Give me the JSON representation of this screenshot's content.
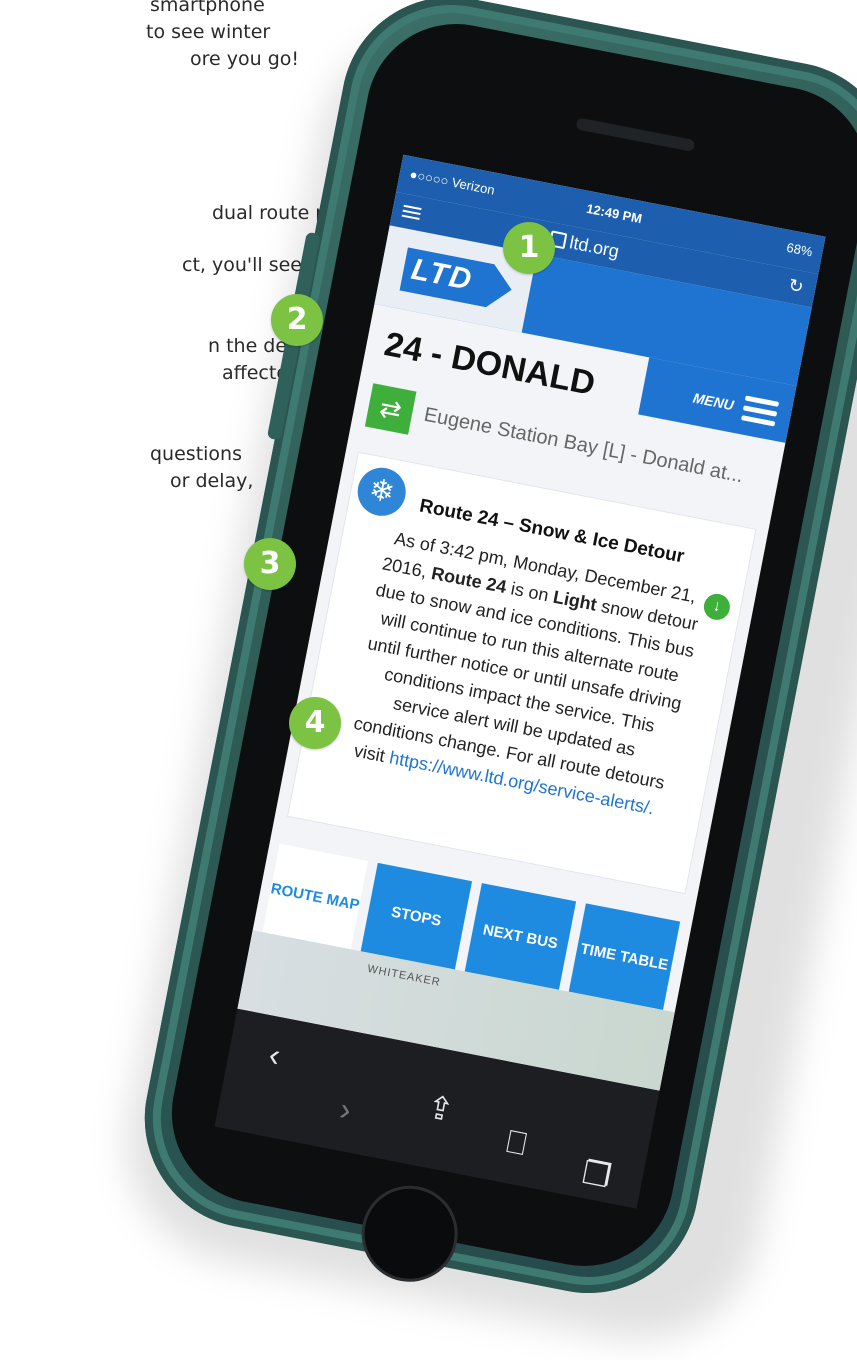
{
  "caption": {
    "line_a": "smartphone",
    "line_b": "to see winter",
    "line_c": "ore you go!",
    "line_d": "dual route page",
    "line_e": "ct, you'll see a",
    "line_f": "n the detour to",
    "line_g": "affected",
    "line_h": "questions",
    "line_i": "or delay,"
  },
  "status": {
    "carrier": "●○○○○ Verizon",
    "time": "12:49 PM",
    "battery": "68%"
  },
  "browser": {
    "url": "ltd.org"
  },
  "site": {
    "logo": "LTD",
    "menu_label": "MENU"
  },
  "route": {
    "title": "24 - DONALD",
    "direction": "Eugene Station Bay [L] - Donald at..."
  },
  "alert": {
    "title": "Route 24 – Snow & Ice Detour",
    "body_1": "As of 3:42 pm, Monday, December 21, 2016,",
    "route_bold": "Route 24",
    "body_2": "is on",
    "light_bold": "Light",
    "body_3": "snow detour due to snow and ice conditions. This bus will continue to run this alternate route until further notice or until unsafe driving conditions impact the service. This service alert will be updated as conditions change. For all route detours visit",
    "link": "https://www.ltd.org/service-alerts/."
  },
  "tabs": {
    "route_map": "ROUTE MAP",
    "stops": "STOPS",
    "next_bus": "NEXT BUS",
    "time_table": "TIME TABLE"
  },
  "map": {
    "label": "WHITEAKER"
  },
  "badges": {
    "one": "1",
    "two": "2",
    "three": "3",
    "four": "4"
  },
  "icons": {
    "snow": "snowflake-icon",
    "direction": "swap-arrows-icon",
    "chevron": "chevron-down-icon",
    "back": "back-icon",
    "forward": "forward-icon",
    "share": "share-icon",
    "bookmarks": "bookmarks-icon",
    "tabs": "tabs-icon"
  },
  "colors": {
    "brand_blue": "#1f74d1",
    "accent_green": "#7cc243",
    "phone_case": "#2e5a54"
  }
}
